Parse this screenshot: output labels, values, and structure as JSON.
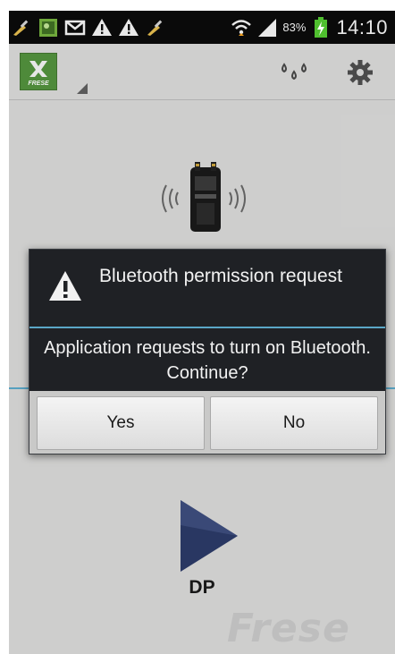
{
  "status_bar": {
    "battery_percent": "83%",
    "time": "14:10",
    "icons": [
      "broom-icon",
      "image-icon",
      "gmail-icon",
      "warning-icon",
      "warning-icon",
      "broom-icon",
      "wifi-icon",
      "signal-icon",
      "battery-charging-icon"
    ]
  },
  "action_bar": {
    "logo_text": "FRESE"
  },
  "dialog": {
    "title": "Bluetooth permission request",
    "message": "Application requests to turn on Bluetooth. Continue?",
    "yes_label": "Yes",
    "no_label": "No"
  },
  "main": {
    "action_label": "DP",
    "brand_watermark": "Frese"
  },
  "colors": {
    "accent_line": "#5aa7c7",
    "dialog_bg": "#1f2125",
    "screen_bg": "#d7d7d6",
    "play_blue": "#2b3a66"
  }
}
